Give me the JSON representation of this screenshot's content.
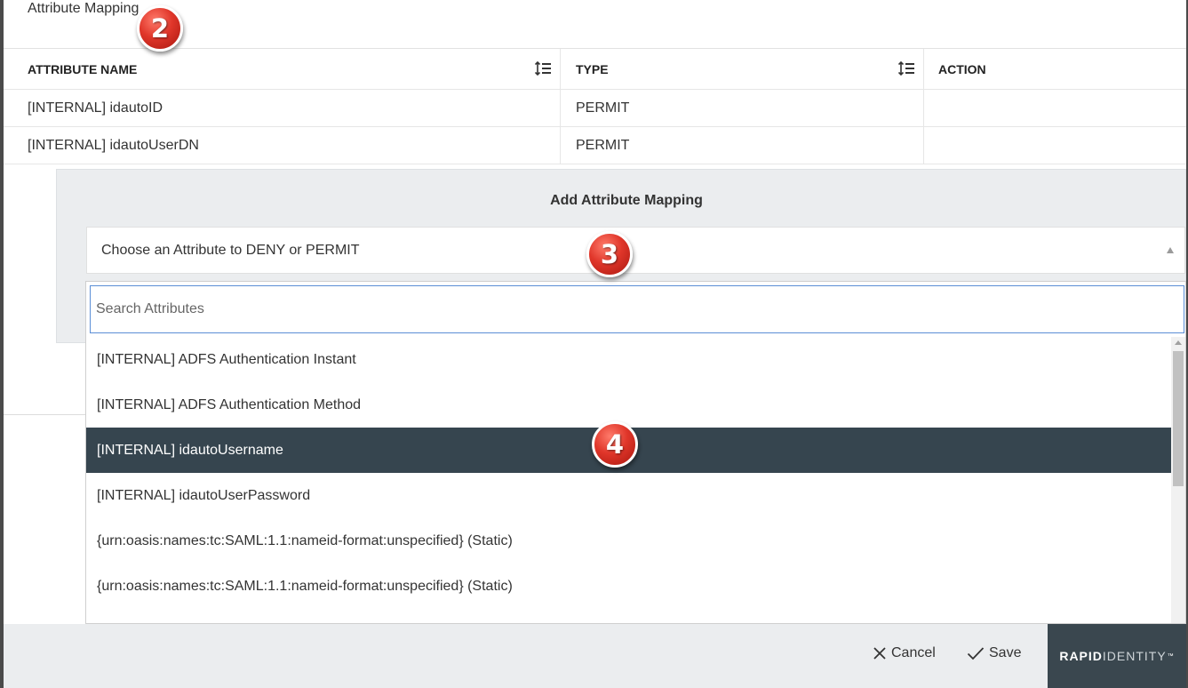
{
  "section": {
    "title": "Attribute Mapping"
  },
  "table": {
    "headers": [
      "ATTRIBUTE NAME",
      "TYPE",
      "ACTION"
    ],
    "rows": [
      {
        "name": "[INTERNAL] idautoID",
        "type": "PERMIT",
        "action": ""
      },
      {
        "name": "[INTERNAL] idautoUserDN",
        "type": "PERMIT",
        "action": ""
      }
    ]
  },
  "add_mapping": {
    "title": "Add Attribute Mapping",
    "select_value": "Choose an Attribute to DENY or PERMIT"
  },
  "dropdown": {
    "search_placeholder": "Search Attributes",
    "search_value": "",
    "options": [
      "[INTERNAL] ADFS Authentication Instant",
      "[INTERNAL] ADFS Authentication Method",
      "[INTERNAL] idautoUsername",
      "[INTERNAL] idautoUserPassword",
      "{urn:oasis:names:tc:SAML:1.1:nameid-format:unspecified} (Static)",
      "{urn:oasis:names:tc:SAML:1.1:nameid-format:unspecified} (Static)"
    ],
    "highlighted_index": 2
  },
  "footer": {
    "cancel_label": "Cancel",
    "save_label": "Save",
    "brand_bold": "RAPID",
    "brand_light": "IDENTITY",
    "brand_mark": "™"
  },
  "callouts": {
    "step_2": "2",
    "step_3": "3",
    "step_4": "4"
  },
  "colors": {
    "highlight": "#36454f",
    "panel": "#ebedef",
    "brand_bg": "#3a474f",
    "callout": "#e0362a",
    "search_border": "#5b8ed6"
  },
  "icons": {
    "sort": "sort-lines-icon",
    "cancel": "close-icon",
    "save": "check-icon",
    "select": "caret-up-icon"
  }
}
